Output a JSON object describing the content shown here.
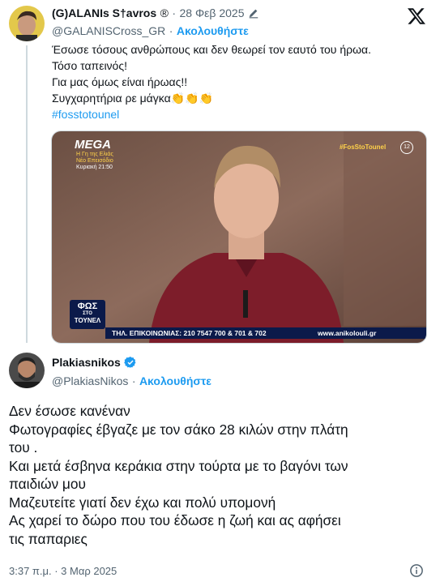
{
  "brand_colors": {
    "accent": "#1d9bf0",
    "text": "#0f1419",
    "muted": "#536471",
    "verified": "#1d9bf0"
  },
  "quoted_tweet": {
    "display_name": "(G)ALANIs S†avros",
    "registered_mark": "®",
    "separator": "·",
    "date": "28 Φεβ 2025",
    "edit_icon": "pencil-icon",
    "handle": "@GALANISCross_GR",
    "follow_label": "Ακολουθήστε",
    "lines": [
      "Έσωσε τόσους ανθρώπους και δεν θεωρεί τον εαυτό του ήρωα.",
      "Τόσο ταπεινός!",
      "Για μας όμως είναι ήρωας!!",
      "Συγχαρητήρια ρε μάγκα"
    ],
    "clap_emoji": "👏",
    "hashtag": "#fosstotounel",
    "media": {
      "channel_logo": "MEGA",
      "tv_info_1": "Η Γη της Ελιάς",
      "tv_info_2": "Νέο Επεισόδιο",
      "tv_info_3": "Κυριακή 21:50",
      "show_tag": "#FosStoTounel",
      "rating": "12",
      "show_logo_line1": "ΦΩΣ",
      "show_logo_line2": "ΣΤΟ",
      "show_logo_line3": "ΤΟΥΝΕΛ",
      "ticker": "ΤΗΛ. ΕΠΙΚΟΙΝΩΝΙΑΣ: 210 7547 700 & 701 & 702",
      "website": "www.anikolouli.gr"
    }
  },
  "main_tweet": {
    "display_name": "Plakiasnikos",
    "verified_icon": "verified-badge-icon",
    "handle": "@PlakiasNikos",
    "separator": "·",
    "follow_label": "Ακολουθήστε",
    "lines": [
      "Δεν έσωσε κανέναν",
      "Φωτογραφίες έβγαζε με τον σάκο 28 κιλών στην πλάτη",
      "του .",
      "Και μετά έσβηνα κεράκια στην τούρτα με το βαγόνι των",
      "παιδιών μου",
      "Μαζευτείτε γιατί δεν έχω και πολύ υπομονή",
      "Ας χαρεί το δώρο που του έδωσε η ζωή και ας αφήσει",
      "τις παπαριες"
    ],
    "timestamp": "3:37 π.μ. · 3 Μαρ 2025",
    "info_icon": "info-icon"
  },
  "x_logo": "x-logo-icon"
}
